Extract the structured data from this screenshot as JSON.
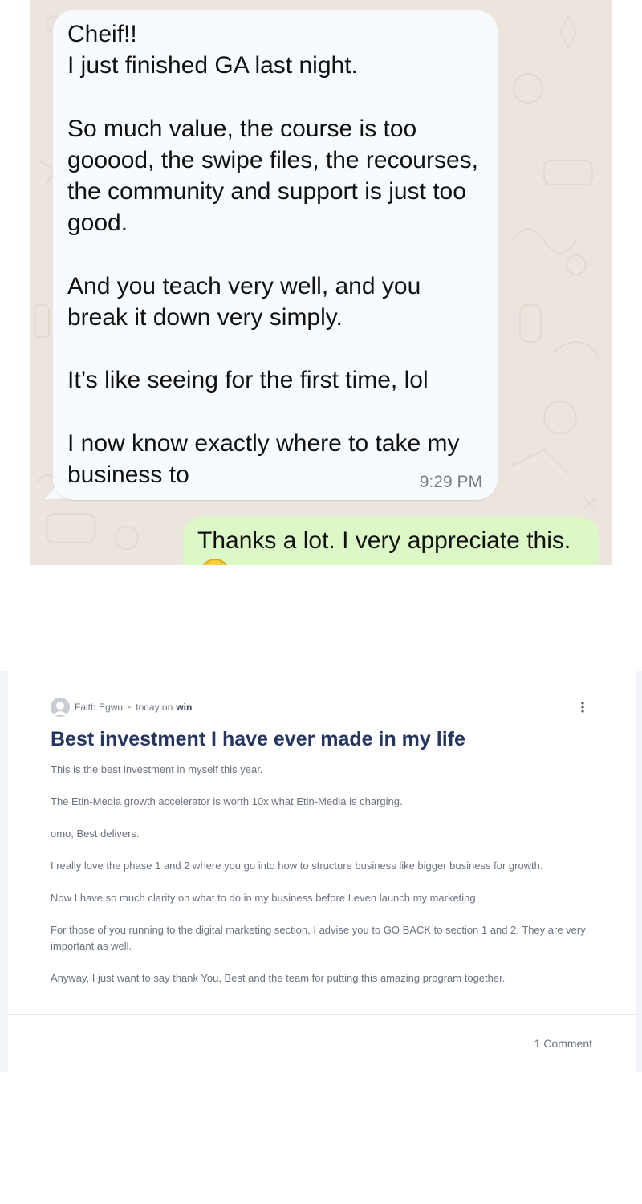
{
  "chat": {
    "incoming_message": "Cheif!!\nI just finished GA last night.\n\nSo much value, the course is too gooood, the swipe files, the recourses, the community and support is just too good.\n\nAnd you teach very well, and you break it down very simply.\n\nIt’s like seeing for the first time, lol\n\nI now know exactly where to take my business to",
    "incoming_time": "9:29 PM",
    "outgoing_message": "Thanks a lot. I very appreciate this.",
    "colors": {
      "background": "#ece5dd",
      "incoming_bubble": "#f7fbfd",
      "outgoing_bubble": "#dcf8c6"
    }
  },
  "post": {
    "author": "Faith Egwu",
    "time": "today on",
    "space": "win",
    "title": "Best investment I have ever made in my life",
    "paragraphs": [
      "This is the best investment in myself this year.",
      "The Etin-Media growth accelerator is worth 10x what Etin-Media is charging.",
      "omo, Best delivers.",
      "I really love the phase 1 and 2 where you go into how to structure business like bigger business for growth.",
      "Now I have so much clarity on what to do in my business before I even launch my marketing.",
      "For those of you running to the digital marketing section, I advise you to GO BACK to section 1 and 2. They are very important as well.",
      "Anyway, I just want to say thank You, Best and the team for putting this amazing program together."
    ],
    "comments_label": "1 Comment",
    "icons": {
      "avatar": "user-avatar-icon",
      "menu": "more-vertical-icon"
    },
    "colors": {
      "title": "#24365f",
      "body_text": "#6b7280"
    }
  }
}
